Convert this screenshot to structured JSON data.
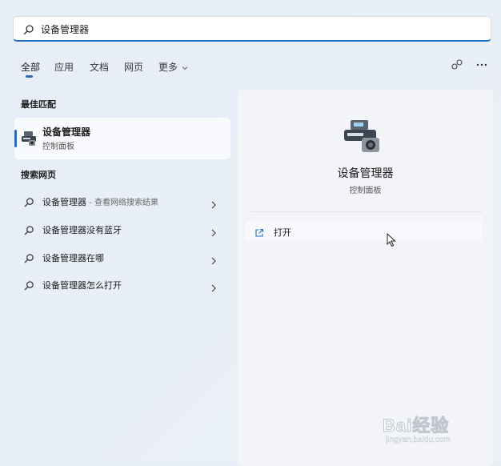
{
  "search": {
    "query": "设备管理器"
  },
  "tabs": [
    {
      "label": "全部"
    },
    {
      "label": "应用"
    },
    {
      "label": "文档"
    },
    {
      "label": "网页"
    },
    {
      "label": "更多"
    }
  ],
  "header_icons": [
    "share-icon",
    "more-icon"
  ],
  "best_match": {
    "section_title": "最佳匹配",
    "title": "设备管理器",
    "subtitle": "控制面板"
  },
  "web_search": {
    "section_title": "搜索网页",
    "items": [
      {
        "label": "设备管理器",
        "suffix": " - 查看网络搜索结果"
      },
      {
        "label": "设备管理器没有蓝牙",
        "suffix": ""
      },
      {
        "label": "设备管理器在哪",
        "suffix": ""
      },
      {
        "label": "设备管理器怎么打开",
        "suffix": ""
      }
    ]
  },
  "detail": {
    "title": "设备管理器",
    "subtitle": "控制面板",
    "actions": [
      {
        "label": "打开"
      }
    ]
  },
  "watermark": {
    "brand": "Bai经验",
    "url": "jingyan.baidu.com"
  },
  "colors": {
    "accent": "#1f6fc4",
    "panel": "#f2f4f8"
  }
}
